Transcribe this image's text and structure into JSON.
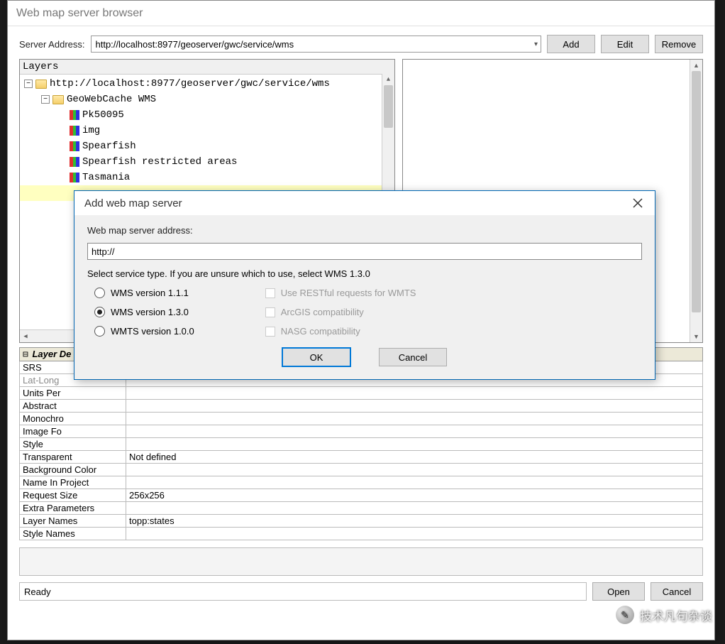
{
  "window": {
    "title": "Web map server browser"
  },
  "top": {
    "label": "Server Address:",
    "value": "http://localhost:8977/geoserver/gwc/service/wms",
    "buttons": {
      "add": "Add",
      "edit": "Edit",
      "remove": "Remove"
    }
  },
  "layers": {
    "header": "Layers",
    "root": "http://localhost:8977/geoserver/gwc/service/wms",
    "group": "GeoWebCache WMS",
    "items": [
      "Pk50095",
      "img",
      "Spearfish",
      "Spearfish restricted areas",
      "Tasmania"
    ]
  },
  "details": {
    "header_left": "Layer De",
    "rows": [
      {
        "k": "SRS",
        "v": ""
      },
      {
        "k": "Lat-Long",
        "v": "",
        "dim": true
      },
      {
        "k": "Units Per",
        "v": ""
      },
      {
        "k": "Abstract",
        "v": ""
      },
      {
        "k": "Monochro",
        "v": ""
      },
      {
        "k": "Image Fo",
        "v": ""
      },
      {
        "k": "Style",
        "v": ""
      },
      {
        "k": "Transparent",
        "v": "Not defined"
      },
      {
        "k": "Background Color",
        "v": ""
      },
      {
        "k": "Name In Project",
        "v": ""
      },
      {
        "k": "Request Size",
        "v": "256x256"
      },
      {
        "k": "Extra Parameters",
        "v": ""
      },
      {
        "k": "Layer Names",
        "v": "topp:states"
      },
      {
        "k": "Style Names",
        "v": ""
      }
    ]
  },
  "status": {
    "ready": "Ready",
    "open": "Open",
    "cancel": "Cancel"
  },
  "dialog": {
    "title": "Add web map server",
    "label": "Web map server address:",
    "value": "http://",
    "hint": "Select service type. If you are unsure which to use, select WMS 1.3.0",
    "radios": [
      "WMS version 1.1.1",
      "WMS version 1.3.0",
      "WMTS version 1.0.0"
    ],
    "selected": 1,
    "checks": [
      "Use RESTful requests for WMTS",
      "ArcGIS compatibility",
      "NASG compatibility"
    ],
    "ok": "OK",
    "cancel": "Cancel"
  },
  "watermark": "技术凡句杂谈"
}
